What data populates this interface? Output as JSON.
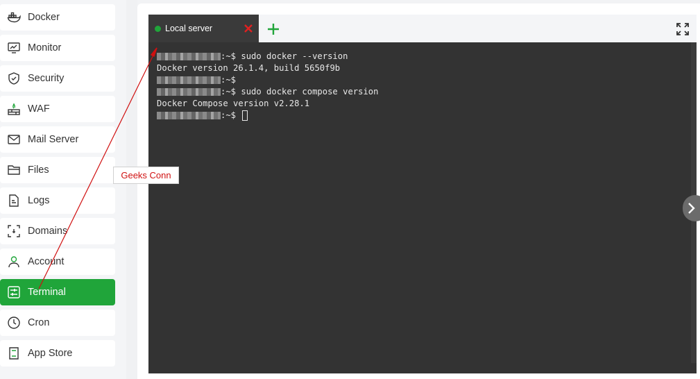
{
  "sidebar": {
    "items": [
      {
        "label": "Docker",
        "icon": "docker-icon"
      },
      {
        "label": "Monitor",
        "icon": "monitor-icon"
      },
      {
        "label": "Security",
        "icon": "shield-icon"
      },
      {
        "label": "WAF",
        "icon": "waf-icon"
      },
      {
        "label": "Mail Server",
        "icon": "mail-icon"
      },
      {
        "label": "Files",
        "icon": "folder-icon"
      },
      {
        "label": "Logs",
        "icon": "log-icon"
      },
      {
        "label": "Domains",
        "icon": "domains-icon"
      },
      {
        "label": "Account",
        "icon": "user-icon"
      },
      {
        "label": "Terminal",
        "icon": "terminal-icon",
        "active": true
      },
      {
        "label": "Cron",
        "icon": "clock-icon"
      },
      {
        "label": "App Store",
        "icon": "store-icon"
      }
    ]
  },
  "tabs": {
    "active_label": "Local server",
    "status_color": "#20a53a"
  },
  "terminal": {
    "lines": [
      {
        "prompt": ":~$",
        "text": " sudo docker --version"
      },
      {
        "output": "Docker version 26.1.4, build 5650f9b"
      },
      {
        "prompt": ":~$",
        "text": ""
      },
      {
        "prompt": ":~$",
        "text": " sudo docker compose version"
      },
      {
        "output": "Docker Compose version v2.28.1"
      },
      {
        "prompt": ":~$",
        "text": " "
      }
    ]
  },
  "annotation": {
    "label": "Geeks Conn",
    "color": "#d01010"
  },
  "colors": {
    "accent": "#20a53a",
    "terminal_bg": "#333333",
    "close": "#e02020"
  }
}
